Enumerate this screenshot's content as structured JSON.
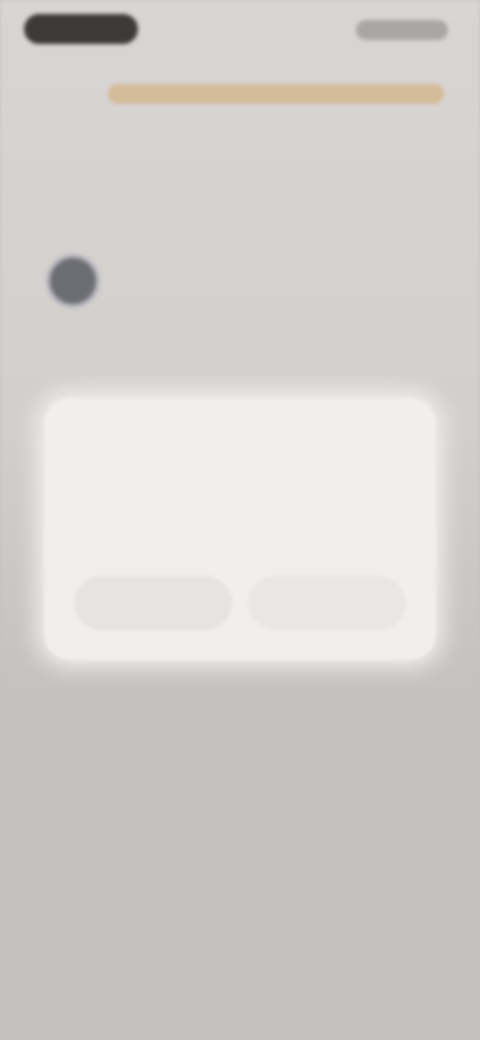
{
  "status_bar": {
    "left_pill": "",
    "right_indicators": ""
  },
  "page": {
    "headline": "",
    "profile": {
      "name": "",
      "subtitle": ""
    }
  },
  "dialog": {
    "title": "",
    "body": "",
    "buttons": {
      "secondary": "",
      "primary": ""
    }
  },
  "colors": {
    "backdrop": "#c4c1bf",
    "dialog_background": "#f1eeed",
    "accent": "#d3b68f",
    "status_pill": "#3d3a3a"
  }
}
